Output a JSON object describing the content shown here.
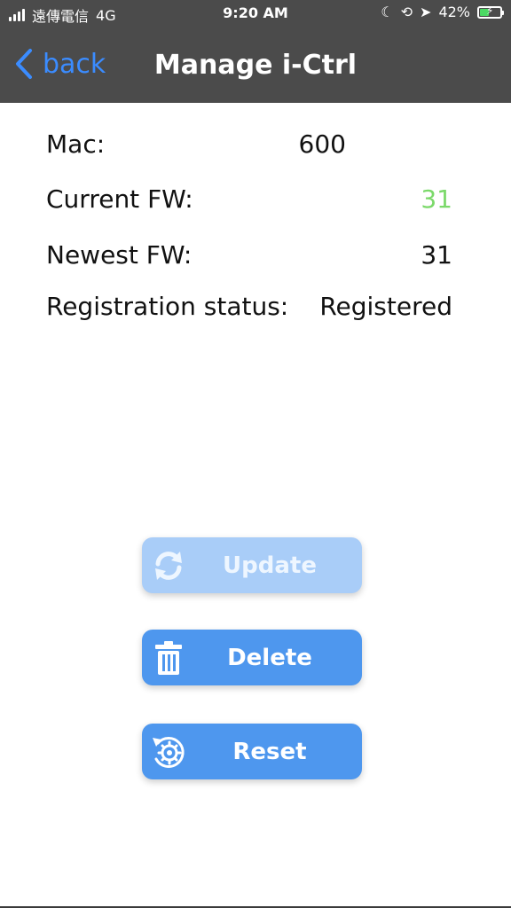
{
  "status_bar": {
    "carrier": "遠傳電信",
    "network": "4G",
    "time": "9:20 AM",
    "battery_percent": "42%",
    "icons": [
      "moon-icon",
      "rotation-lock-icon",
      "location-icon",
      "battery-charging-icon"
    ]
  },
  "nav": {
    "back_label": "back",
    "title": "Manage i-Ctrl"
  },
  "info": {
    "mac_label": "Mac:",
    "mac_value": "600",
    "current_fw_label": "Current FW:",
    "current_fw_value": "31",
    "newest_fw_label": "Newest FW:",
    "newest_fw_value": "31",
    "registration_label": "Registration status:",
    "registration_value": "Registered"
  },
  "buttons": {
    "update_label": "Update",
    "delete_label": "Delete",
    "reset_label": "Reset"
  },
  "colors": {
    "bar": "#4b4b4b",
    "accent": "#3b8cff",
    "button_blue": "#4e97ee",
    "button_disabled": "#a9cdf8",
    "fw_green": "#7bd96a"
  }
}
